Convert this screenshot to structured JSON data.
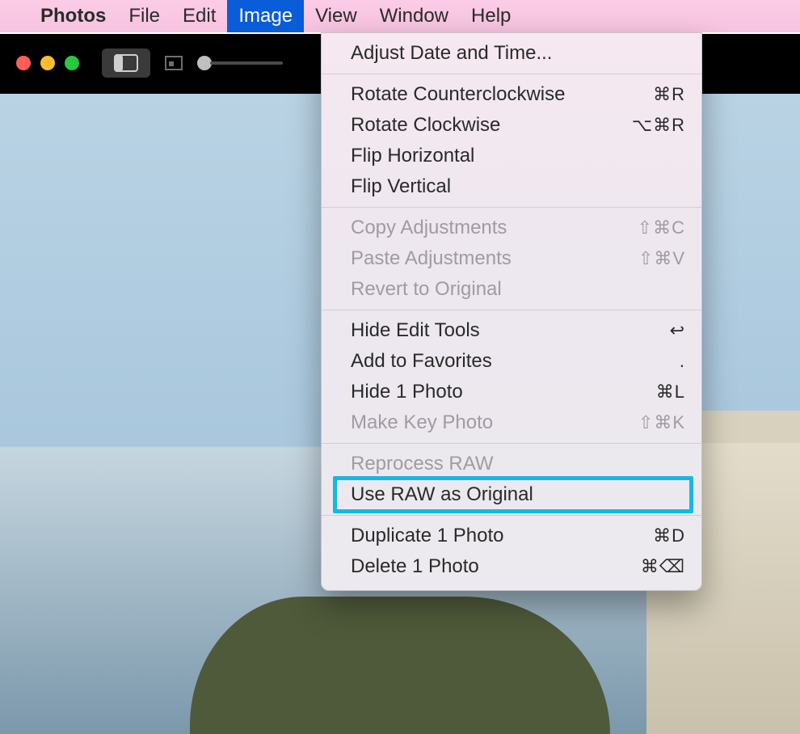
{
  "menubar": {
    "app": "Photos",
    "items": [
      "File",
      "Edit",
      "Image",
      "View",
      "Window",
      "Help"
    ],
    "active": "Image"
  },
  "menu": {
    "groups": [
      [
        {
          "label": "Adjust Date and Time...",
          "shortcut": "",
          "disabled": false
        }
      ],
      [
        {
          "label": "Rotate Counterclockwise",
          "shortcut": "⌘R",
          "disabled": false
        },
        {
          "label": "Rotate Clockwise",
          "shortcut": "⌥⌘R",
          "disabled": false
        },
        {
          "label": "Flip Horizontal",
          "shortcut": "",
          "disabled": false
        },
        {
          "label": "Flip Vertical",
          "shortcut": "",
          "disabled": false
        }
      ],
      [
        {
          "label": "Copy Adjustments",
          "shortcut": "⇧⌘C",
          "disabled": true
        },
        {
          "label": "Paste Adjustments",
          "shortcut": "⇧⌘V",
          "disabled": true
        },
        {
          "label": "Revert to Original",
          "shortcut": "",
          "disabled": true
        }
      ],
      [
        {
          "label": "Hide Edit Tools",
          "shortcut": "↩",
          "disabled": false
        },
        {
          "label": "Add to Favorites",
          "shortcut": ".",
          "disabled": false
        },
        {
          "label": "Hide 1 Photo",
          "shortcut": "⌘L",
          "disabled": false
        },
        {
          "label": "Make Key Photo",
          "shortcut": "⇧⌘K",
          "disabled": true
        }
      ],
      [
        {
          "label": "Reprocess RAW",
          "shortcut": "",
          "disabled": true
        },
        {
          "label": "Use RAW as Original",
          "shortcut": "",
          "disabled": false,
          "highlighted": true
        }
      ],
      [
        {
          "label": "Duplicate 1 Photo",
          "shortcut": "⌘D",
          "disabled": false
        },
        {
          "label": "Delete 1 Photo",
          "shortcut": "⌘⌫",
          "disabled": false
        }
      ]
    ]
  }
}
